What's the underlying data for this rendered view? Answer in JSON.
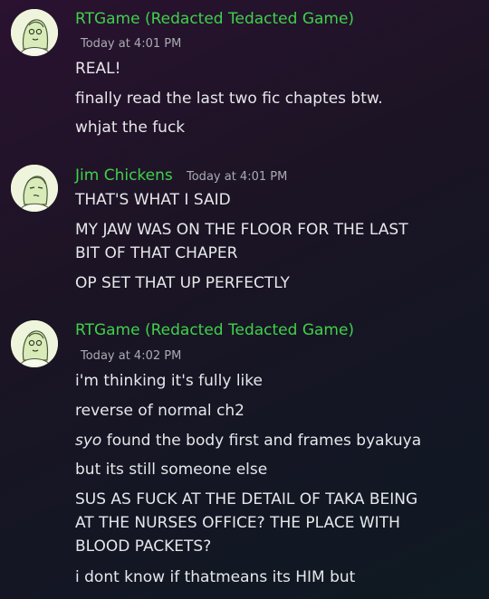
{
  "messages": [
    {
      "author": "RTGame (Redacted Tedacted Game)",
      "timestamp": "Today at 4:01 PM",
      "lines": [
        "REAL!",
        "finally read the last two fic chaptes btw.",
        "whjat the fuck"
      ]
    },
    {
      "author": "Jim Chickens",
      "timestamp": "Today at 4:01 PM",
      "lines": [
        "THAT'S WHAT I SAID",
        "MY JAW WAS ON THE FLOOR FOR THE LAST BIT OF THAT CHAPER",
        "OP SET THAT UP PERFECTLY"
      ]
    },
    {
      "author": "RTGame (Redacted Tedacted Game)",
      "timestamp": "Today at 4:02 PM",
      "lines": [
        "i'm thinking it's fully like",
        "reverse of normal ch2",
        "found the body first and frames byakuya",
        "but its still someone else",
        "SUS AS FUCK AT THE DETAIL OF TAKA BEING AT THE NURSES OFFICE? THE PLACE WITH BLOOD PACKETS?",
        "i dont know if thatmeans its HIM but"
      ],
      "italic_word": "syo"
    }
  ],
  "colors": {
    "author": "#3fd14a",
    "text": "#e6e7ea",
    "timestamp": "#a9acb3"
  },
  "icons": {
    "avatar_1": "avatar-sketch-icon",
    "avatar_2": "avatar-sketch-icon",
    "avatar_3": "avatar-sketch-icon"
  }
}
